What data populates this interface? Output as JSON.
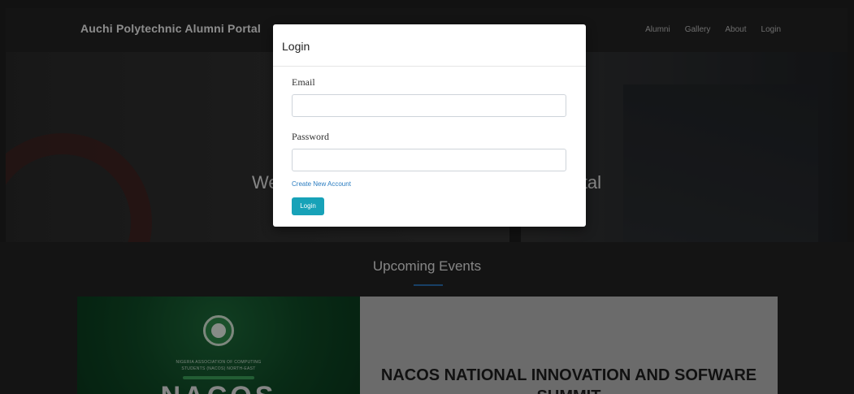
{
  "navbar": {
    "brand": "Auchi Polytechnic Alumni Portal",
    "links": [
      "Alumni",
      "Gallery",
      "About",
      "Login"
    ]
  },
  "hero": {
    "title": "Welcome to Auchi Polytechnic Alumni Portal"
  },
  "events": {
    "heading": "Upcoming Events",
    "card": {
      "title": "NACOS NATIONAL INNOVATION AND SOFWARE SUMMIT",
      "image_text": {
        "org_line_1": "NIGERIA ASSOCIATION OF COMPUTING",
        "org_line_2": "STUDENTS (NACOS) NORTH-EAST",
        "big_text": "NACOS"
      }
    }
  },
  "modal": {
    "title": "Login",
    "email_label": "Email",
    "email_value": "",
    "password_label": "Password",
    "password_value": "",
    "create_account_link": "Create New Account",
    "login_button": "Login"
  },
  "colors": {
    "accent": "#17a2b8",
    "link": "#2a7cc0",
    "heading_underline": "#2a6fb0"
  }
}
